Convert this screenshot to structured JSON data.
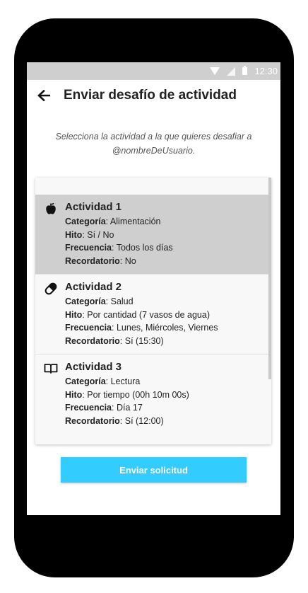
{
  "status_bar": {
    "time": "12:30"
  },
  "app_bar": {
    "title": "Enviar desafío de actividad"
  },
  "intro_text": "Selecciona la actividad a la que quieres desafiar a @nombreDeUsuario.",
  "labels": {
    "category": "Categoría",
    "milestone": "Hito",
    "frequency": "Frecuencia",
    "reminder": "Recordatorio"
  },
  "activities": [
    {
      "name": "Actividad 1",
      "icon": "apple-icon",
      "category": "Alimentación",
      "milestone": "Sí / No",
      "frequency": "Todos los días",
      "reminder": "No",
      "selected": true
    },
    {
      "name": "Actividad 2",
      "icon": "pill-icon",
      "category": "Salud",
      "milestone": "Por cantidad (7 vasos de agua)",
      "frequency": "Lunes, Miércoles, Viernes",
      "reminder": "Sí (15:30)",
      "selected": false
    },
    {
      "name": "Actividad 3",
      "icon": "book-icon",
      "category": "Lectura",
      "milestone": "Por tiempo (00h 10m 00s)",
      "frequency": "Día 17",
      "reminder": "Sí (12:00)",
      "selected": false
    }
  ],
  "send_button_label": "Enviar solicitud"
}
